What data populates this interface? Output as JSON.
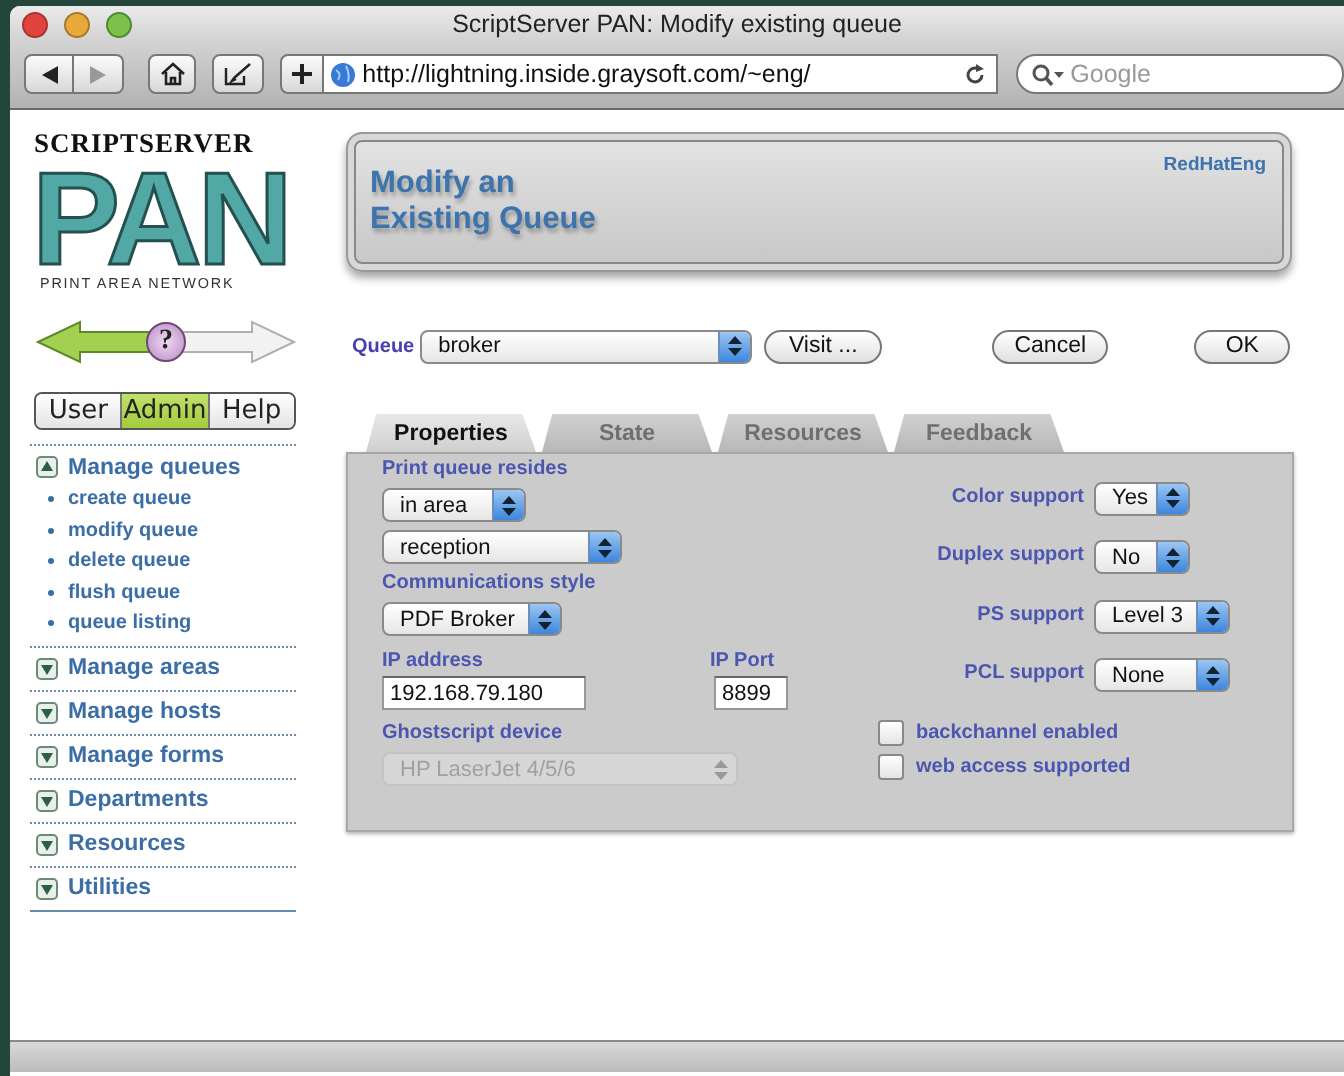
{
  "window": {
    "title": "ScriptServer PAN: Modify existing queue"
  },
  "toolbar": {
    "url": "http://lightning.inside.graysoft.com/~eng/",
    "search": {
      "placeholder": "Google"
    }
  },
  "logo": {
    "brand": "SCRIPTSERVER",
    "mark": "PAN",
    "tagline": "PRINT AREA NETWORK"
  },
  "help_button": "?",
  "mode_tabs": [
    {
      "label": "User",
      "selected": false
    },
    {
      "label": "Admin",
      "selected": true
    },
    {
      "label": "Help",
      "selected": false
    }
  ],
  "menu": [
    {
      "label": "Manage queues",
      "expanded": true,
      "children": [
        {
          "label": "create queue"
        },
        {
          "label": "modify queue"
        },
        {
          "label": "delete queue"
        },
        {
          "label": "flush queue"
        },
        {
          "label": "queue listing"
        }
      ]
    },
    {
      "label": "Manage areas",
      "expanded": false
    },
    {
      "label": "Manage hosts",
      "expanded": false
    },
    {
      "label": "Manage forms",
      "expanded": false
    },
    {
      "label": "Departments",
      "expanded": false
    },
    {
      "label": "Resources",
      "expanded": false
    },
    {
      "label": "Utilities",
      "expanded": false
    }
  ],
  "header": {
    "title_lines": [
      "Modify an",
      "Existing Queue"
    ],
    "user": "RedHatEng"
  },
  "queue": {
    "label": "Queue",
    "value": "broker",
    "visit": "Visit ...",
    "cancel": "Cancel",
    "ok": "OK"
  },
  "tabs": [
    {
      "label": "Properties",
      "selected": true
    },
    {
      "label": "State",
      "selected": false
    },
    {
      "label": "Resources",
      "selected": false
    },
    {
      "label": "Feedback",
      "selected": false
    }
  ],
  "properties": {
    "resides": {
      "label": "Print queue resides",
      "location_type": "in area",
      "area": "reception"
    },
    "communications": {
      "label": "Communications style",
      "value": "PDF Broker"
    },
    "ip_address": {
      "label": "IP address",
      "value": "192.168.79.180"
    },
    "ip_port": {
      "label": "IP Port",
      "value": "8899"
    },
    "ghostscript": {
      "label": "Ghostscript device",
      "value": "HP LaserJet 4/5/6",
      "disabled": true
    },
    "supports": [
      {
        "label": "Color support",
        "value": "Yes"
      },
      {
        "label": "Duplex support",
        "value": "No"
      },
      {
        "label": "PS support",
        "value": "Level 3"
      },
      {
        "label": "PCL support",
        "value": "None"
      }
    ],
    "checkboxes": [
      {
        "label": "backchannel enabled",
        "checked": false
      },
      {
        "label": "web access supported",
        "checked": false
      }
    ]
  }
}
